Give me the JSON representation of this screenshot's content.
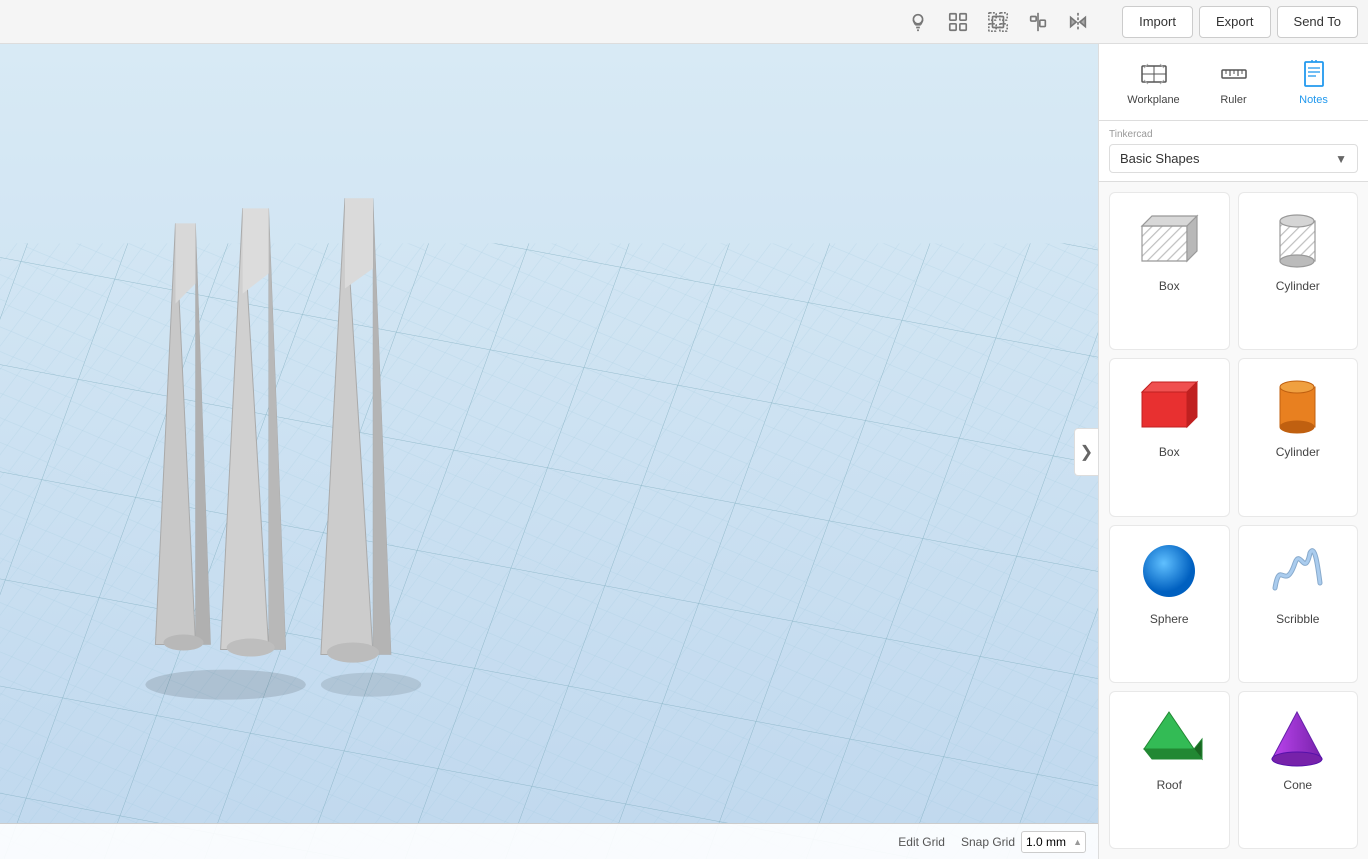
{
  "toolbar": {
    "import_label": "Import",
    "export_label": "Export",
    "send_to_label": "Send To"
  },
  "panel_tools": [
    {
      "id": "workplane",
      "label": "Workplane",
      "icon": "grid"
    },
    {
      "id": "ruler",
      "label": "Ruler",
      "icon": "ruler"
    },
    {
      "id": "notes",
      "label": "Notes",
      "icon": "notes"
    }
  ],
  "shape_library": {
    "provider": "Tinkercad",
    "name": "Basic Shapes"
  },
  "shapes": [
    {
      "id": "box-gray",
      "label": "Box",
      "color": "#bbb",
      "type": "box-wire"
    },
    {
      "id": "cylinder-gray",
      "label": "Cylinder",
      "color": "#bbb",
      "type": "cylinder-wire"
    },
    {
      "id": "box-red",
      "label": "Box",
      "color": "#e83030",
      "type": "box-solid"
    },
    {
      "id": "cylinder-orange",
      "label": "Cylinder",
      "color": "#e88020",
      "type": "cylinder-solid"
    },
    {
      "id": "sphere-blue",
      "label": "Sphere",
      "color": "#2090e8",
      "type": "sphere"
    },
    {
      "id": "scribble",
      "label": "Scribble",
      "color": "#88bbdd",
      "type": "scribble"
    },
    {
      "id": "roof-green",
      "label": "Roof",
      "color": "#22aa44",
      "type": "roof"
    },
    {
      "id": "cone-purple",
      "label": "Cone",
      "color": "#9933cc",
      "type": "cone"
    }
  ],
  "bottom_bar": {
    "edit_grid_label": "Edit Grid",
    "snap_grid_label": "Snap Grid",
    "snap_grid_value": "1.0 mm"
  }
}
